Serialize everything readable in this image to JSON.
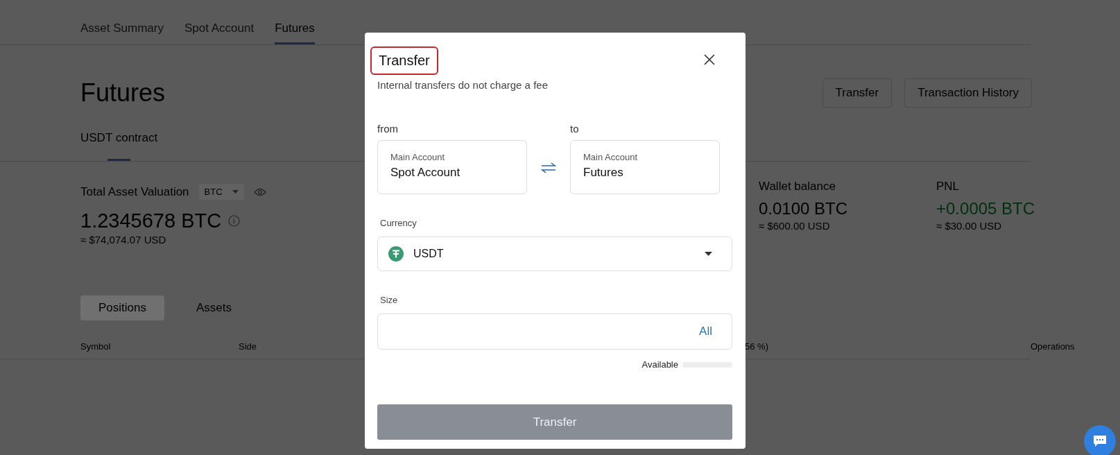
{
  "nav_tabs": [
    {
      "label": "Asset Summary",
      "selected": false
    },
    {
      "label": "Spot Account",
      "selected": false
    },
    {
      "label": "Futures",
      "selected": true
    }
  ],
  "page_title": "Futures",
  "header_buttons": [
    "Transfer",
    "Transaction History"
  ],
  "sub_tabs": [
    {
      "label": "USDT contract",
      "selected": true
    }
  ],
  "valuation": {
    "label": "Total Asset Valuation",
    "currency": "BTC",
    "amount": "1.2345678 BTC",
    "usd": "≈ $74,074.07 USD"
  },
  "stats": [
    {
      "label": "Wallet balance",
      "value": "0.0100 BTC",
      "usd": "≈ $600.00 USD",
      "kind": "neutral"
    },
    {
      "label": "PNL",
      "value": "+0.0005 BTC",
      "usd": "≈ $30.00 USD",
      "kind": "gain"
    }
  ],
  "list_tabs": [
    {
      "label": "Positions",
      "selected": true
    },
    {
      "label": "Assets",
      "selected": false
    }
  ],
  "table": {
    "columns": [
      "Symbol",
      "Side",
      "56 %)",
      "Operations"
    ]
  },
  "dialog": {
    "title": "Transfer",
    "title_highlighted": true,
    "subtitle": "Internal transfers do not charge a fee",
    "from": {
      "label": "from",
      "caption": "Main Account",
      "account": "Spot Account"
    },
    "to": {
      "label": "to",
      "caption": "Main Account",
      "account": "Futures"
    },
    "currency": {
      "label": "Currency",
      "value": "USDT"
    },
    "size": {
      "label": "Size",
      "all": "All"
    },
    "available": {
      "label": "Available"
    },
    "submit": {
      "label": "Transfer",
      "disabled": true
    }
  }
}
